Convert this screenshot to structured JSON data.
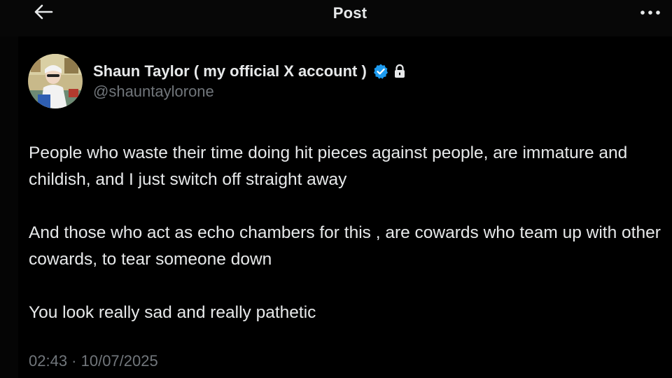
{
  "header": {
    "title": "Post",
    "back_icon": "arrow-left-icon",
    "more_icon": "more-horizontal-icon"
  },
  "author": {
    "display_name": "Shaun Taylor ( my official X account )",
    "handle": "@shauntaylorone",
    "verified": true,
    "protected": true,
    "verified_color": "#1d9bf0"
  },
  "post": {
    "paragraphs": [
      "People who waste their time doing hit pieces against people, are immature and childish, and I just switch off straight away",
      "And those who act as echo chambers for this , are cowards who team up with other cowards, to tear someone down",
      "You look really sad and really pathetic"
    ],
    "timestamp": "02:43 · 10/07/2025"
  },
  "colors": {
    "background": "#000000",
    "text_primary": "#e7e9ea",
    "text_secondary": "#71767b"
  }
}
